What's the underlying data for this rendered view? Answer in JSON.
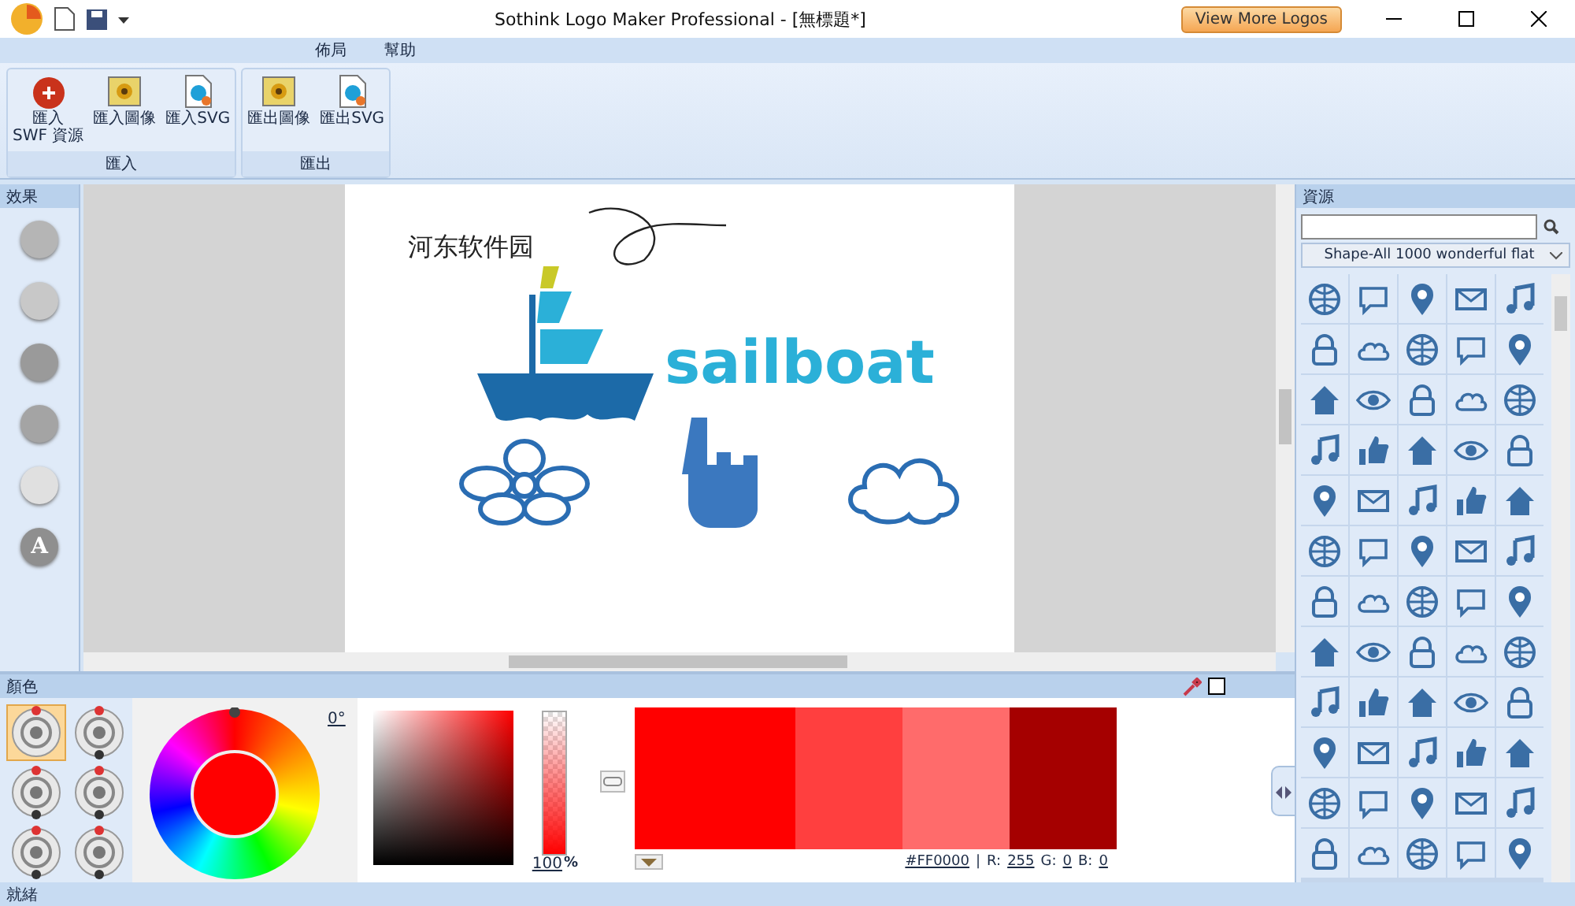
{
  "window": {
    "title": "Sothink Logo Maker Professional - [無標題*]",
    "promo_button": "View More Logos"
  },
  "menu": [
    "佈局",
    "幫助"
  ],
  "ribbon": {
    "groups": [
      {
        "label": "匯入",
        "buttons": [
          {
            "kind": "swf",
            "label": "匯入\nSWF 資源"
          },
          {
            "kind": "image",
            "label": "匯入圖像"
          },
          {
            "kind": "svg",
            "label": "匯入SVG"
          }
        ]
      },
      {
        "label": "匯出",
        "buttons": [
          {
            "kind": "image",
            "label": "匯出圖像"
          },
          {
            "kind": "svg",
            "label": "匯出SVG"
          }
        ]
      }
    ]
  },
  "effects_panel": {
    "title": "效果",
    "buttons": [
      {
        "kind": "flat"
      },
      {
        "kind": "bevel"
      },
      {
        "kind": "glow"
      },
      {
        "kind": "reflect"
      },
      {
        "kind": "gloss"
      },
      {
        "kind": "letter",
        "label": "A"
      }
    ]
  },
  "canvas": {
    "caption": "河东软件园",
    "logo_text": "sailboat"
  },
  "resources_panel": {
    "title": "資源",
    "category": "Shape-All 1000 wonderful flat"
  },
  "color_panel": {
    "title": "顏色",
    "presets": [
      {
        "selected": true
      },
      {
        "selected": false
      },
      {
        "selected": false
      },
      {
        "selected": false
      },
      {
        "selected": false
      },
      {
        "selected": false
      }
    ],
    "hue": "0°",
    "alpha": {
      "value": "100",
      "unit": "%",
      "level": 1
    },
    "swatches": [
      {
        "color": "#ff0000"
      },
      {
        "color": "#ff3f3f"
      },
      {
        "color": "#ff6b6b"
      },
      {
        "color": "#a50000"
      }
    ],
    "hex": "#FF0000",
    "separator": "|",
    "r_label": "R:",
    "r": "255",
    "g_label": "G:",
    "g": "0",
    "b_label": "B:",
    "b": "0"
  },
  "status_bar": "就緒"
}
